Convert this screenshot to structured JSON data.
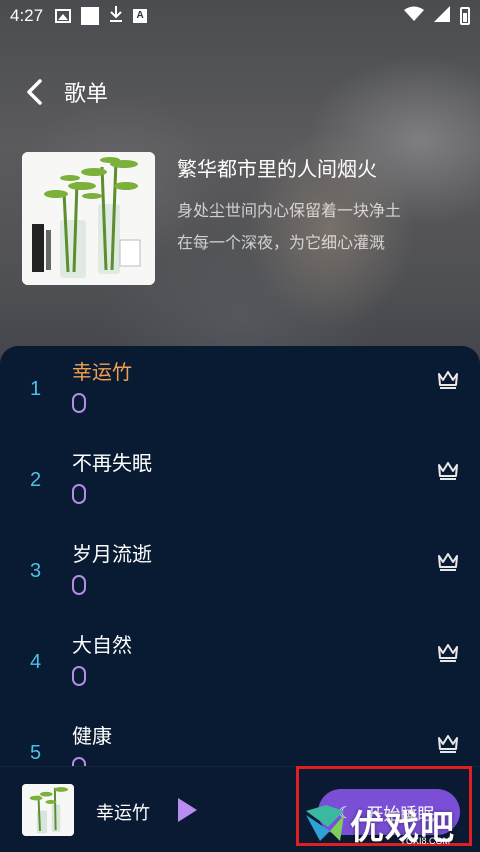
{
  "status_bar": {
    "time": "4:27"
  },
  "header": {
    "title": "歌单"
  },
  "album": {
    "title": "繁华都市里的人间烟火",
    "desc_line1": "身处尘世间内心保留着一块净土",
    "desc_line2": "在每一个深夜，为它细心灌溉"
  },
  "tracks": [
    {
      "num": "1",
      "name": "幸运竹",
      "active": true
    },
    {
      "num": "2",
      "name": "不再失眠",
      "active": false
    },
    {
      "num": "3",
      "name": "岁月流逝",
      "active": false
    },
    {
      "num": "4",
      "name": "大自然",
      "active": false
    },
    {
      "num": "5",
      "name": "健康",
      "active": false
    }
  ],
  "player": {
    "title": "幸运竹",
    "sleep_label": "开始睡眠"
  },
  "watermark": {
    "text": "优戏吧",
    "sub": "YOXI8.COM"
  },
  "colors": {
    "list_bg": "#091a33",
    "accent_orange": "#f0a050",
    "number_cyan": "#4ec0e8",
    "button_purple": "#7a4fd6",
    "highlight_red": "#e02020"
  },
  "icons": [
    "back-icon",
    "crown-icon",
    "play-icon",
    "moon-icon",
    "wifi-icon",
    "signal-icon",
    "battery-icon"
  ]
}
